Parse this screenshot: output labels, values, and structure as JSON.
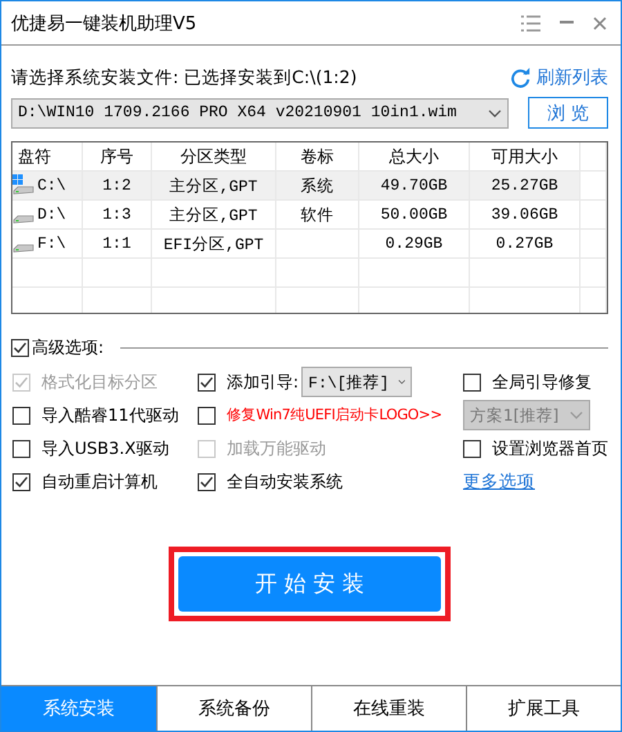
{
  "window": {
    "title": "优捷易一键装机助理V5"
  },
  "file_prompt": "请选择系统安装文件: 已选择安装到C:\\(1:2)",
  "refresh_link": "刷新列表",
  "file_select": {
    "value": "D:\\WIN10 1709.2166 PRO X64 v20210901 10in1.wim"
  },
  "browse_button": "浏 览",
  "table": {
    "columns": [
      "盘符",
      "序号",
      "分区类型",
      "卷标",
      "总大小",
      "可用大小"
    ],
    "rows": [
      {
        "kind": "system",
        "selected": true,
        "cells": [
          "C:\\",
          "1:2",
          "主分区,GPT",
          "系统",
          "49.70GB",
          "25.27GB"
        ]
      },
      {
        "kind": "drive",
        "selected": false,
        "cells": [
          "D:\\",
          "1:3",
          "主分区,GPT",
          "软件",
          "50.00GB",
          "39.06GB"
        ]
      },
      {
        "kind": "drive",
        "selected": false,
        "cells": [
          "F:\\",
          "1:1",
          "EFI分区,GPT",
          "",
          "0.29GB",
          "0.27GB"
        ]
      }
    ]
  },
  "advanced": {
    "label": "高级选项:",
    "checked": true
  },
  "options": [
    {
      "kind": "checkbox",
      "label": "格式化目标分区",
      "checked": true,
      "disabled": true
    },
    {
      "kind": "checkbox",
      "label": "添加引导:",
      "checked": true,
      "disabled": false,
      "dropdown": {
        "value": "F:\\[推荐]",
        "disabled": false
      }
    },
    {
      "kind": "checkbox",
      "label": "全局引导修复",
      "checked": false,
      "disabled": false
    },
    {
      "kind": "checkbox",
      "label": "导入酷睿11代驱动",
      "checked": false,
      "disabled": false
    },
    {
      "kind": "warning",
      "label": "修复Win7纯UEFI启动卡LOGO>>",
      "checked": false,
      "disabled": false
    },
    {
      "kind": "dropdown",
      "value": "方案1[推荐]",
      "disabled": true
    },
    {
      "kind": "checkbox",
      "label": "导入USB3.X驱动",
      "checked": false,
      "disabled": false
    },
    {
      "kind": "checkbox",
      "label": "加载万能驱动",
      "checked": false,
      "disabled": true
    },
    {
      "kind": "checkbox",
      "label": "设置浏览器首页",
      "checked": false,
      "disabled": false
    },
    {
      "kind": "checkbox",
      "label": "自动重启计算机",
      "checked": true,
      "disabled": false
    },
    {
      "kind": "checkbox",
      "label": "全自动安装系统",
      "checked": true,
      "disabled": false
    },
    {
      "kind": "link",
      "label": "更多选项"
    }
  ],
  "start_button": "开 始 安 装",
  "tabs": [
    {
      "label": "系统安装",
      "selected": true
    },
    {
      "label": "系统备份",
      "selected": false
    },
    {
      "label": "在线重装",
      "selected": false
    },
    {
      "label": "扩展工具",
      "selected": false
    }
  ]
}
